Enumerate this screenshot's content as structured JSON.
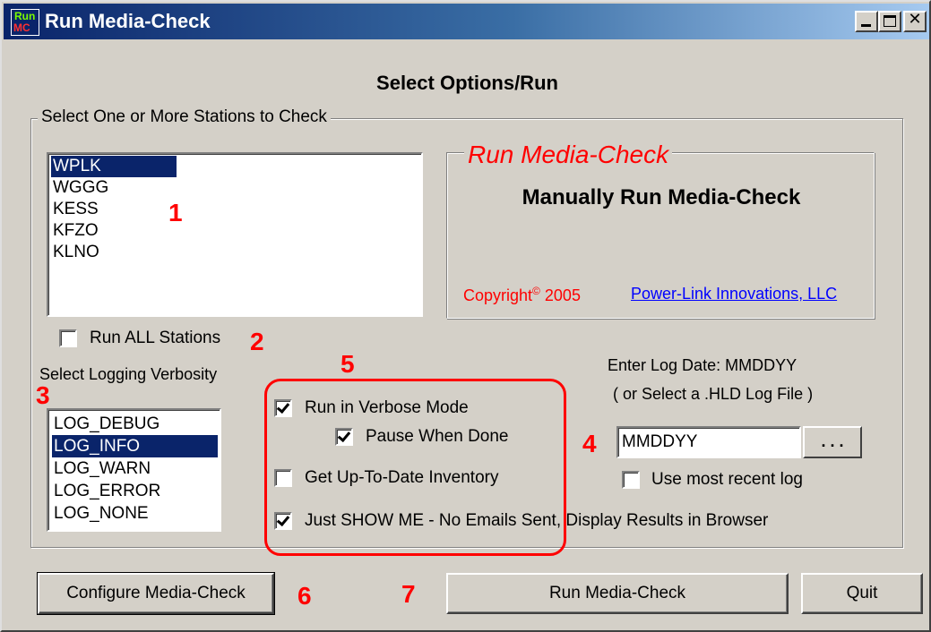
{
  "window": {
    "title": "Run Media-Check",
    "icon_text_top": "Run",
    "icon_text_bottom": "MC",
    "minimize_glyph": "_",
    "close_glyph": "✕"
  },
  "heading": "Select Options/Run",
  "stations_group": {
    "legend": "Select One or More Stations to Check",
    "items": [
      "WPLK",
      "WGGG",
      "KESS",
      "KFZO",
      "KLNO"
    ],
    "selected": "WPLK"
  },
  "info_panel": {
    "legend": "Run Media-Check",
    "main_text": "Manually Run Media-Check",
    "copyright": "Copyright",
    "copyright_symbol": "©",
    "copyright_year": "2005",
    "company": "Power-Link Innovations, LLC"
  },
  "run_all": {
    "label": "Run ALL Stations",
    "checked": false
  },
  "verbosity": {
    "label": "Select Logging Verbosity",
    "items": [
      "LOG_DEBUG",
      "LOG_INFO",
      "LOG_WARN",
      "LOG_ERROR",
      "LOG_NONE"
    ],
    "selected": "LOG_INFO"
  },
  "options": {
    "verbose": {
      "label": "Run in Verbose Mode",
      "checked": true
    },
    "pause": {
      "label": "Pause When Done",
      "checked": true
    },
    "inventory": {
      "label": "Get Up-To-Date Inventory",
      "checked": false
    },
    "show_me": {
      "label": "Just SHOW ME - No Emails Sent, Display Results in Browser",
      "checked": true
    }
  },
  "log_date": {
    "label_line1": "Enter Log Date:  MMDDYY",
    "label_line2": "( or Select a .HLD Log File )",
    "value": "MMDDYY",
    "browse_label": ". . .",
    "use_recent_label": "Use most recent log",
    "use_recent_checked": false
  },
  "buttons": {
    "configure": "Configure Media-Check",
    "run": "Run Media-Check",
    "quit": "Quit"
  },
  "callouts": [
    "1",
    "2",
    "3",
    "4",
    "5",
    "6",
    "7"
  ],
  "colors": {
    "face": "#d4d0c8",
    "selection": "#0a246a",
    "annotation": "#ff0000",
    "link": "#0000ff"
  }
}
